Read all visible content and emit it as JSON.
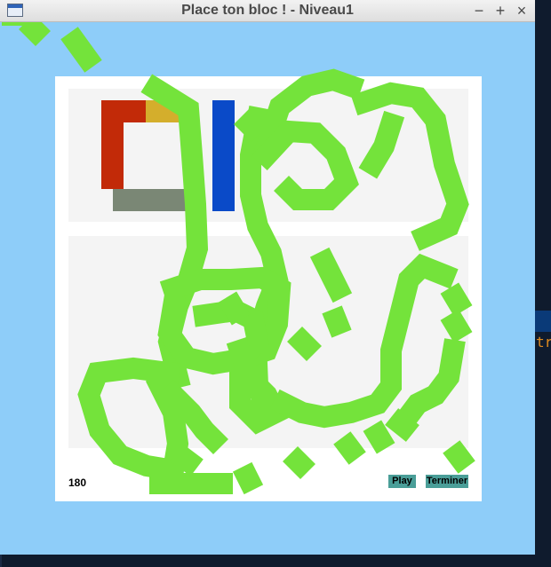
{
  "window": {
    "title": "Place ton bloc ! - Niveau1",
    "controls": {
      "minimize": "−",
      "maximize": "+",
      "close": "×"
    }
  },
  "game": {
    "score": "180",
    "play_label": "Play",
    "finish_label": "Terminer",
    "blocks": [
      {
        "name": "red-L-block",
        "color": "#c22a08"
      },
      {
        "name": "yellow-block",
        "color": "#d4ae2c"
      },
      {
        "name": "gray-block",
        "color": "#7a8775"
      },
      {
        "name": "blue-block",
        "color": "#0a4ac8"
      }
    ],
    "drawing_color": "#74e33b",
    "background_color": "#8ecdf9"
  },
  "desktop": {
    "partial_text": "tr"
  }
}
